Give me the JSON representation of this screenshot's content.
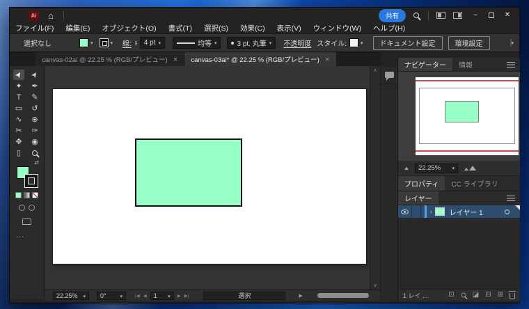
{
  "colors": {
    "accent_blue": "#2878e0",
    "fill_green": "#99ffc9",
    "shape_stroke": "#101010",
    "layer_selected_row": "#2d4e6e",
    "navigator_red": "#cc4b4b",
    "none_red": "#cf2b2b"
  },
  "titlebar": {
    "app_logo": "Ai",
    "share": "共有",
    "minimize": "–",
    "close": "✕"
  },
  "menu": {
    "items": [
      "ファイル(F)",
      "編集(E)",
      "オブジェクト(O)",
      "書式(T)",
      "選択(S)",
      "効果(C)",
      "表示(V)",
      "ウィンドウ(W)",
      "ヘルプ(H)"
    ]
  },
  "control": {
    "selection_status": "選択なし",
    "stroke_label": "線:",
    "stroke_width": "4 pt",
    "width_profile": "均等",
    "brush": "3 pt. 丸筆",
    "opacity": "不透明度",
    "style": "スタイル:",
    "document_setup": "ドキュメント設定",
    "preferences": "環境設定"
  },
  "doc_tabs": {
    "tab1": "canvas-02ai @ 22.25 % (RGB/プレビュー)",
    "tab2": "canvas-03ai* @ 22.25 % (RGB/プレビュー)",
    "close_glyph": "✕"
  },
  "tools": [
    {
      "name": "selection-tool",
      "glyph": "➤",
      "active": true
    },
    {
      "name": "direct-selection-tool",
      "glyph": "➤"
    },
    {
      "name": "magic-wand-tool",
      "glyph": "✦"
    },
    {
      "name": "pen-tool",
      "glyph": "✒"
    },
    {
      "name": "type-tool",
      "glyph": "T"
    },
    {
      "name": "paintbrush-tool",
      "glyph": "✎"
    },
    {
      "name": "rectangle-tool",
      "glyph": "▭"
    },
    {
      "name": "rotate-tool",
      "glyph": "↺"
    },
    {
      "name": "shaper-tool",
      "glyph": "∿"
    },
    {
      "name": "shape-builder-tool",
      "glyph": "⊕"
    },
    {
      "name": "scissors-tool",
      "glyph": "✂"
    },
    {
      "name": "eyedropper-tool",
      "glyph": "✑"
    },
    {
      "name": "hand-tool",
      "glyph": "✥"
    },
    {
      "name": "width-tool",
      "glyph": "◉"
    },
    {
      "name": "artboard-tool",
      "glyph": "▯"
    },
    {
      "name": "zoom-tool"
    }
  ],
  "toolbar_extras": {
    "swap_glyph": "⇄",
    "more_glyph": "..."
  },
  "navigator": {
    "tab_navigator": "ナビゲーター",
    "tab_info": "情報",
    "zoom_value": "22.25%"
  },
  "panels": {
    "tab_properties": "プロパティ",
    "tab_cc": "CC ライブラリ",
    "layers_title": "レイヤー",
    "layer_name": "レイヤー 1",
    "layers_count": "1 レイ ...",
    "layers_icons": {
      "export": "⊡",
      "mask": "◪",
      "sublayer": "⊟",
      "new_layer": "⊞"
    }
  },
  "statusbar": {
    "zoom": "22.25%",
    "rotation": "0°",
    "artboard": "1",
    "tool": "選択",
    "nav": {
      "first": "|◀",
      "prev": "◀",
      "next": "▶",
      "last": "▶|"
    }
  }
}
